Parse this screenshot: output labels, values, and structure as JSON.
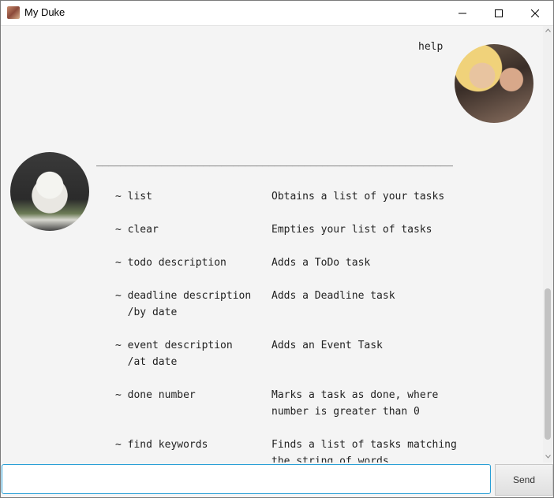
{
  "window": {
    "title": "My Duke",
    "icon": "app-avatar-icon"
  },
  "chat": {
    "user_message": "help",
    "bot_rule": "____________________________________________________________",
    "commands": [
      {
        "command": "~ list",
        "description": "Obtains a list of your tasks"
      },
      {
        "command": "~ clear",
        "description": "Empties your list of tasks"
      },
      {
        "command": "~ todo description",
        "description": "Adds a ToDo task"
      },
      {
        "command": "~ deadline description\n  /by date",
        "description": "Adds a Deadline task"
      },
      {
        "command": "~ event description\n  /at date",
        "description": "Adds an Event Task"
      },
      {
        "command": "~ done number",
        "description": "Marks a task as done, where\nnumber is greater than 0"
      },
      {
        "command": "~ find keywords",
        "description": "Finds a list of tasks matching\nthe string of words"
      }
    ]
  },
  "input": {
    "value": "",
    "placeholder": ""
  },
  "send_button": {
    "label": "Send"
  },
  "colors": {
    "accent": "#2a9fd6",
    "chat_bg": "#f4f4f4"
  }
}
